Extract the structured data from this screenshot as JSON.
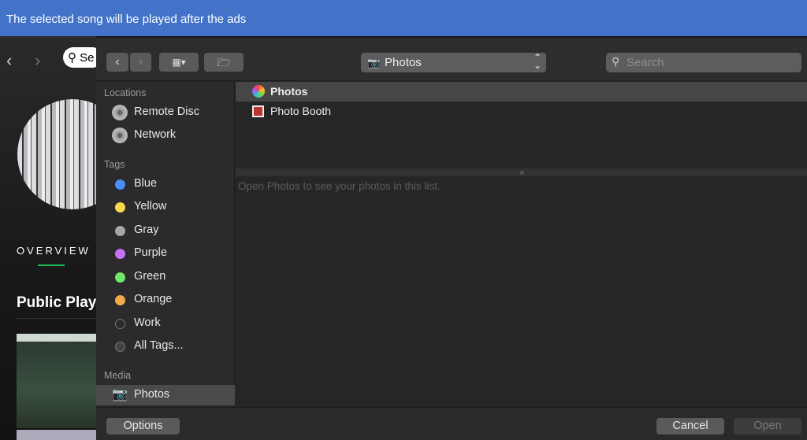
{
  "banner": {
    "text": "The selected song will be played after the ads"
  },
  "background_app": {
    "search_text": "Se",
    "overview_tab": "OVERVIEW",
    "section_title": "Public Play",
    "accent": "#1db954"
  },
  "dialog": {
    "toolbar": {
      "location": "Photos",
      "search_placeholder": "Search"
    },
    "sidebar": {
      "locations_header": "Locations",
      "locations": [
        {
          "label": "Remote Disc",
          "icon": "disc-icon"
        },
        {
          "label": "Network",
          "icon": "network-globe-icon"
        }
      ],
      "tags_header": "Tags",
      "tags": [
        {
          "label": "Blue",
          "color": "#4b8ef7"
        },
        {
          "label": "Yellow",
          "color": "#f5d94b"
        },
        {
          "label": "Gray",
          "color": "#a6a6a6"
        },
        {
          "label": "Purple",
          "color": "#c672f2"
        },
        {
          "label": "Green",
          "color": "#6ee96a"
        },
        {
          "label": "Orange",
          "color": "#f4a94c"
        },
        {
          "label": "Work",
          "color": ""
        },
        {
          "label": "All Tags...",
          "color": ""
        }
      ],
      "media_header": "Media",
      "media": [
        {
          "label": "Photos",
          "icon": "camera-icon",
          "selected": true
        }
      ]
    },
    "files": [
      {
        "name": "Photos",
        "icon": "photos-app-icon",
        "selected": true
      },
      {
        "name": "Photo Booth",
        "icon": "photo-booth-icon",
        "selected": false
      }
    ],
    "hint": "Open Photos to see your photos in this list.",
    "buttons": {
      "options": "Options",
      "cancel": "Cancel",
      "open": "Open"
    }
  }
}
